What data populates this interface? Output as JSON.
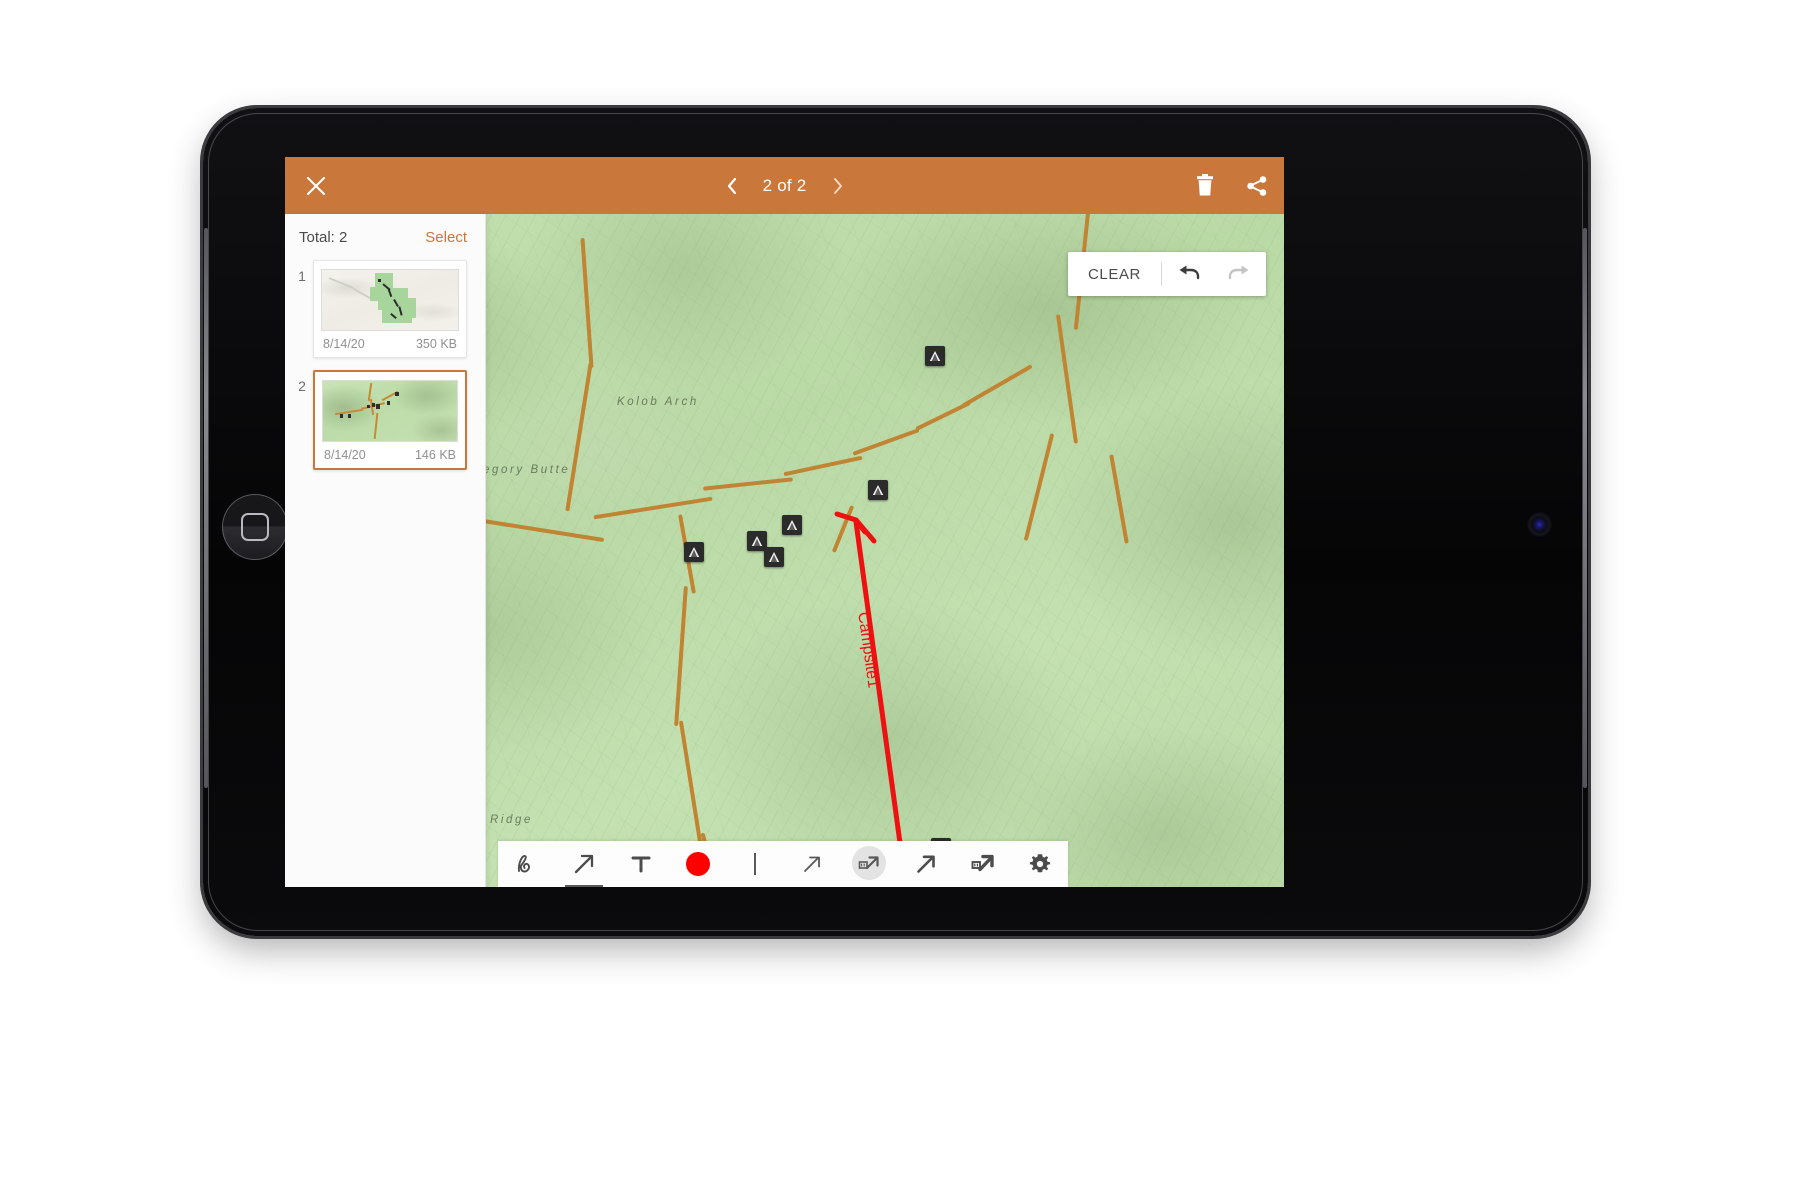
{
  "app": {
    "topbar": {
      "close_icon": "close-icon",
      "prev_icon": "chevron-left-icon",
      "next_icon": "chevron-right-icon",
      "pager_label": "2 of 2",
      "delete_icon": "trash-icon",
      "share_icon": "share-icon",
      "background_color": "#c9773a"
    },
    "sidebar": {
      "total_label": "Total: 2",
      "select_label": "Select",
      "accent_color": "#c9773a",
      "items": [
        {
          "index": "1",
          "date": "8/14/20",
          "size": "350 KB",
          "selected": false
        },
        {
          "index": "2",
          "date": "8/14/20",
          "size": "146 KB",
          "selected": true
        }
      ]
    },
    "edit_panel": {
      "clear_label": "CLEAR",
      "undo_icon": "undo-arrow-icon",
      "redo_icon": "redo-arrow-icon",
      "undo_enabled": "true",
      "redo_enabled": "false"
    },
    "map": {
      "labels": [
        {
          "text": "Kolob Arch"
        },
        {
          "text": "Gregory Butte"
        },
        {
          "text": "le Ridge"
        }
      ],
      "marker_icon": "campsite-tent-icon",
      "marker_count": "7",
      "trail_color": "#c08433"
    },
    "annotation": {
      "text": "Campsite1",
      "color": "#ee1111",
      "shape": "arrow"
    },
    "toolbar": {
      "tools": [
        {
          "name": "freehand-draw-tool",
          "icon": "scribble-icon",
          "state": "inactive"
        },
        {
          "name": "arrow-tool",
          "icon": "arrow-up-right-icon",
          "state": "underline"
        },
        {
          "name": "text-tool",
          "icon": "text-t-icon",
          "state": "inactive"
        },
        {
          "name": "color-swatch-tool",
          "icon": "red-circle-icon",
          "state": "inactive"
        },
        {
          "name": "stroke-width-tool",
          "icon": "vertical-line-icon",
          "state": "inactive"
        },
        {
          "name": "arrow-thin-tool",
          "icon": "arrow-thin-icon",
          "state": "inactive"
        },
        {
          "name": "arrow-labeled-tool",
          "icon": "arrow-labeled-icon",
          "state": "selected"
        },
        {
          "name": "arrow-medium-tool",
          "icon": "arrow-medium-icon",
          "state": "inactive"
        },
        {
          "name": "arrow-labeled-bold-tool",
          "icon": "arrow-labeled-bold-icon",
          "state": "inactive"
        },
        {
          "name": "settings-tool",
          "icon": "gear-icon",
          "state": "inactive"
        }
      ]
    }
  }
}
